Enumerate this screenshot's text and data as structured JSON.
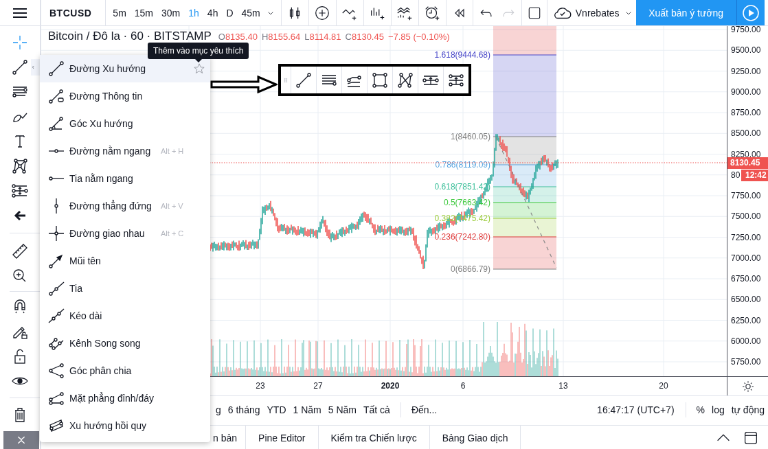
{
  "top_bar": {
    "symbol": "BTCUSD",
    "intervals": [
      {
        "label": "5m",
        "selected": false
      },
      {
        "label": "15m",
        "selected": false
      },
      {
        "label": "30m",
        "selected": false
      },
      {
        "label": "1h",
        "selected": true
      },
      {
        "label": "4h",
        "selected": false
      },
      {
        "label": "D",
        "selected": false
      },
      {
        "label": "45m",
        "selected": false
      }
    ],
    "redo_disabled": true,
    "account": "Vnrebates",
    "publish_button": "Xuất bản ý tưởng"
  },
  "legend": {
    "title": "Bitcoin / Đô la · 60 · BITSTAMP",
    "ohlc": [
      {
        "key": "O",
        "value": "8135.40"
      },
      {
        "key": "H",
        "value": "8155.64"
      },
      {
        "key": "L",
        "value": "8114.81"
      },
      {
        "key": "C",
        "value": "8130.45"
      }
    ],
    "change": "−7.85 (−0.10%)"
  },
  "tooltip": "Thêm vào mục yêu thích",
  "drawing_menu": {
    "items": [
      {
        "label": "Đường Xu hướng",
        "selected": true
      },
      {
        "label": "Đường Thông tin",
        "selected": false
      },
      {
        "label": "Góc Xu hướng",
        "selected": false
      },
      {
        "label": "Đường nằm ngang",
        "shortcut": "Alt + H",
        "selected": false
      },
      {
        "label": "Tia nằm ngang",
        "selected": false
      },
      {
        "label": "Đường thẳng đứng",
        "shortcut": "Alt + V",
        "selected": false
      },
      {
        "label": "Đường giao nhau",
        "shortcut": "Alt + C",
        "selected": false
      },
      {
        "label": "Mũi tên",
        "selected": false
      },
      {
        "label": "Tia",
        "selected": false
      },
      {
        "label": "Kéo dài",
        "selected": false
      },
      {
        "label": "Kênh Song song",
        "selected": false
      },
      {
        "label": "Góc phân chia",
        "selected": false
      },
      {
        "label": "Mặt phẳng đỉnh/đáy",
        "selected": false
      },
      {
        "label": "Xu hướng hồi quy",
        "selected": false
      }
    ]
  },
  "fib_levels": [
    {
      "label": "1.618(9444.68)",
      "color": "#4646c8"
    },
    {
      "label": "1(8460.05)",
      "color": "#808080"
    },
    {
      "label": "0.786(8119.09)",
      "color": "#56a4e0"
    },
    {
      "label": "0.618(7851.42)",
      "color": "#3cbf9a"
    },
    {
      "label": "0.5(7663.42)",
      "color": "#3cc83c"
    },
    {
      "label": "0.382(7475.42)",
      "color": "#9ccc3c"
    },
    {
      "label": "0.236(7242.80)",
      "color": "#e03c3c"
    },
    {
      "label": "0(6866.79)",
      "color": "#808080"
    }
  ],
  "price_axis": {
    "labels": [
      "9750.00",
      "9500.00",
      "9250.00",
      "9000.00",
      "8750.00",
      "8500.00",
      "8250.00",
      "80",
      "7750.00",
      "7500.00",
      "7250.00",
      "7000.00",
      "6750.00",
      "6500.00",
      "6250.00",
      "6000.00",
      "5750.00"
    ],
    "last_price": "8130.45",
    "countdown": "12:42"
  },
  "time_axis": {
    "labels": [
      {
        "text": "23",
        "bold": false
      },
      {
        "text": "27",
        "bold": false
      },
      {
        "text": "2020",
        "bold": true
      },
      {
        "text": "6",
        "bold": false
      },
      {
        "text": "13",
        "bold": false
      },
      {
        "text": "20",
        "bold": false
      }
    ]
  },
  "range_bar": {
    "ranges": [
      "g",
      "6 tháng",
      "YTD",
      "1 Năm",
      "5 Năm",
      "Tất cả"
    ],
    "goto": "Đến...",
    "clock": "16:47:17 (UTC+7)",
    "scale_options": [
      "%",
      "log",
      "tự động"
    ]
  },
  "bottom_tabs": [
    "n bản",
    "Pine Editor",
    "Kiểm tra Chiến lược",
    "Bảng Giao dịch"
  ]
}
